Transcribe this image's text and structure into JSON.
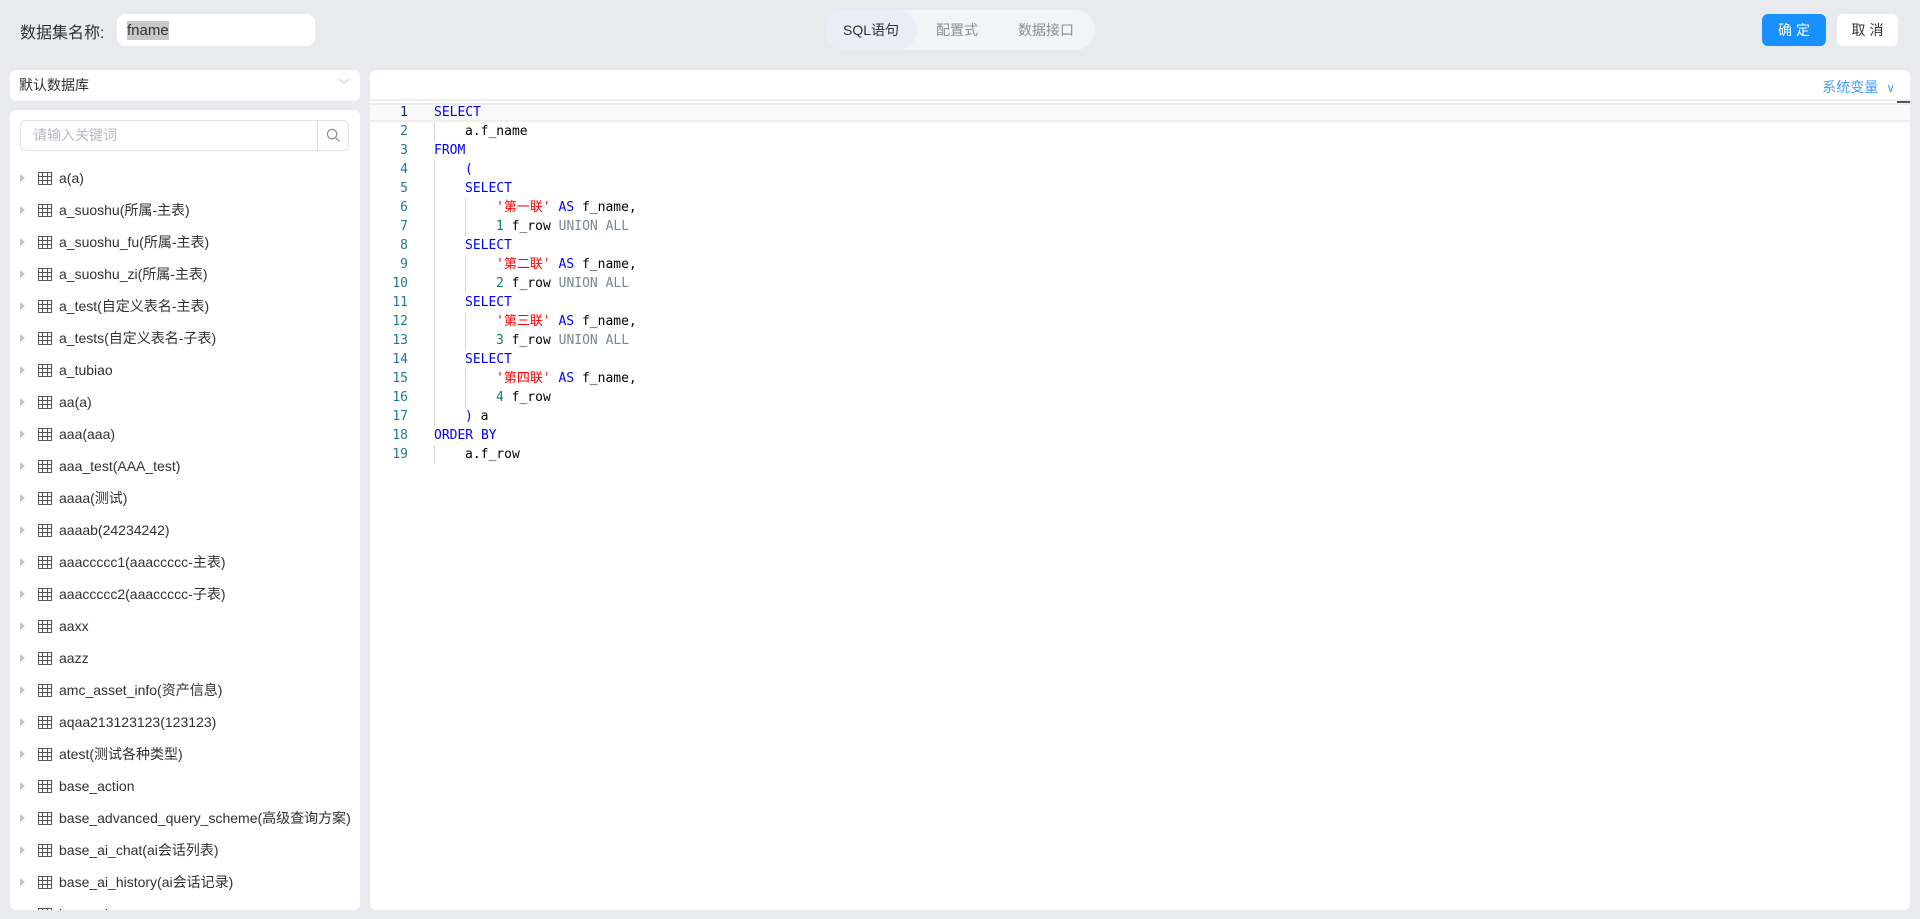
{
  "header": {
    "dataset_label": "数据集名称:",
    "dataset_name": "fname",
    "tabs": [
      {
        "label": "SQL语句",
        "active": true
      },
      {
        "label": "配置式",
        "active": false
      },
      {
        "label": "数据接口",
        "active": false
      }
    ],
    "confirm_label": "确定",
    "cancel_label": "取消"
  },
  "sidebar": {
    "database": "默认数据库",
    "search_placeholder": "请输入关键词",
    "tables": [
      "a(a)",
      "a_suoshu(所属-主表)",
      "a_suoshu_fu(所属-主表)",
      "a_suoshu_zi(所属-主表)",
      "a_test(自定义表名-主表)",
      "a_tests(自定义表名-子表)",
      "a_tubiao",
      "aa(a)",
      "aaa(aaa)",
      "aaa_test(AAA_test)",
      "aaaa(测试)",
      "aaaab(24234242)",
      "aaaccccc1(aaaccccc-主表)",
      "aaaccccc2(aaaccccc-子表)",
      "aaxx",
      "aazz",
      "amc_asset_info(资产信息)",
      "aqaa213123123(123123)",
      "atest(测试各种类型)",
      "base_action",
      "base_advanced_query_scheme(高级查询方案)",
      "base_ai_chat(ai会话列表)",
      "base_ai_history(ai会话记录)",
      "base_ai_..."
    ]
  },
  "editor": {
    "system_variables_label": "系统变量",
    "lines": [
      {
        "n": "1",
        "indent": 0,
        "tokens": [
          [
            "kw",
            "SELECT"
          ]
        ]
      },
      {
        "n": "2",
        "indent": 1,
        "tokens": [
          [
            "",
            "a.f_name"
          ]
        ]
      },
      {
        "n": "3",
        "indent": 0,
        "tokens": [
          [
            "kw",
            "FROM"
          ]
        ]
      },
      {
        "n": "4",
        "indent": 1,
        "tokens": [
          [
            "kw",
            "("
          ]
        ]
      },
      {
        "n": "5",
        "indent": 1,
        "tokens": [
          [
            "kw",
            "SELECT"
          ]
        ]
      },
      {
        "n": "6",
        "indent": 2,
        "tokens": [
          [
            "str",
            "'第一联'"
          ],
          [
            "",
            " "
          ],
          [
            "kw",
            "AS"
          ],
          [
            "",
            " f_name,"
          ]
        ]
      },
      {
        "n": "7",
        "indent": 2,
        "tokens": [
          [
            "num",
            "1"
          ],
          [
            "",
            " f_row "
          ],
          [
            "op",
            "UNION ALL"
          ]
        ]
      },
      {
        "n": "8",
        "indent": 1,
        "tokens": [
          [
            "kw",
            "SELECT"
          ]
        ]
      },
      {
        "n": "9",
        "indent": 2,
        "tokens": [
          [
            "str",
            "'第二联'"
          ],
          [
            "",
            " "
          ],
          [
            "kw",
            "AS"
          ],
          [
            "",
            " f_name,"
          ]
        ]
      },
      {
        "n": "10",
        "indent": 2,
        "tokens": [
          [
            "num",
            "2"
          ],
          [
            "",
            " f_row "
          ],
          [
            "op",
            "UNION ALL"
          ]
        ]
      },
      {
        "n": "11",
        "indent": 1,
        "tokens": [
          [
            "kw",
            "SELECT"
          ]
        ]
      },
      {
        "n": "12",
        "indent": 2,
        "tokens": [
          [
            "str",
            "'第三联'"
          ],
          [
            "",
            " "
          ],
          [
            "kw",
            "AS"
          ],
          [
            "",
            " f_name,"
          ]
        ]
      },
      {
        "n": "13",
        "indent": 2,
        "tokens": [
          [
            "num",
            "3"
          ],
          [
            "",
            " f_row "
          ],
          [
            "op",
            "UNION ALL"
          ]
        ]
      },
      {
        "n": "14",
        "indent": 1,
        "tokens": [
          [
            "kw",
            "SELECT"
          ]
        ]
      },
      {
        "n": "15",
        "indent": 2,
        "tokens": [
          [
            "str",
            "'第四联'"
          ],
          [
            "",
            " "
          ],
          [
            "kw",
            "AS"
          ],
          [
            "",
            " f_name,"
          ]
        ]
      },
      {
        "n": "16",
        "indent": 2,
        "tokens": [
          [
            "num",
            "4"
          ],
          [
            "",
            " f_row"
          ]
        ]
      },
      {
        "n": "17",
        "indent": 1,
        "tokens": [
          [
            "kw",
            ")"
          ],
          [
            "",
            " a"
          ]
        ]
      },
      {
        "n": "18",
        "indent": 0,
        "tokens": [
          [
            "kw",
            "ORDER BY"
          ]
        ]
      },
      {
        "n": "19",
        "indent": 1,
        "tokens": [
          [
            "",
            "a.f_row"
          ]
        ]
      }
    ]
  }
}
